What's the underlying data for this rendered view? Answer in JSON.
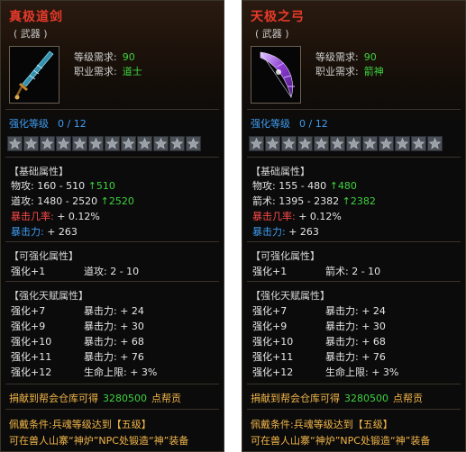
{
  "panels": [
    {
      "name": "真极道剑",
      "type": "( 武器 )",
      "req_level_label": "等级需求:",
      "req_level_value": "90",
      "req_job_label": "职业需求:",
      "req_job_value": "道士",
      "enhance_label": "强化等级",
      "enhance_value": "0 / 12",
      "stars": 12,
      "base_title": "【基础属性】",
      "base_stats": [
        {
          "label": "物攻:",
          "value": "160 - 510",
          "bonus": "510",
          "color": "#e6e6e6"
        },
        {
          "label": "道攻:",
          "value": "1480 - 2520",
          "bonus": "2520",
          "color": "#e6e6e6"
        },
        {
          "label": "暴击几率:",
          "value": "+ 0.12%",
          "bonus": "",
          "color": "#ff4a4a"
        },
        {
          "label": "暴击力:",
          "value": "+ 263",
          "bonus": "",
          "color": "#3e9cf0"
        }
      ],
      "enh_title": "【可强化属性】",
      "enh_left": "强化+1",
      "enh_right": "道攻: 2 - 10",
      "talent_title": "【强化天赋属性】",
      "talents": [
        {
          "lv": "强化+7",
          "attr": "暴击力: + 24"
        },
        {
          "lv": "强化+9",
          "attr": "暴击力: + 30"
        },
        {
          "lv": "强化+10",
          "attr": "暴击力: + 68"
        },
        {
          "lv": "强化+11",
          "attr": "暴击力: + 76"
        },
        {
          "lv": "强化+12",
          "attr": "生命上限: + 3%"
        }
      ],
      "donate_prefix": "捐献到帮会仓库可得",
      "donate_value": "3280500",
      "donate_suffix": "点帮贡",
      "cond1": "佩戴条件:兵魂等级达到【五级】",
      "cond2": "可在兽人山寨“神炉”NPC处锻造“神”装备"
    },
    {
      "name": "天极之弓",
      "type": "( 武器 )",
      "req_level_label": "等级需求:",
      "req_level_value": "90",
      "req_job_label": "职业需求:",
      "req_job_value": "箭神",
      "enhance_label": "强化等级",
      "enhance_value": "0 / 12",
      "stars": 12,
      "base_title": "【基础属性】",
      "base_stats": [
        {
          "label": "物攻:",
          "value": "155 - 480",
          "bonus": "480",
          "color": "#e6e6e6"
        },
        {
          "label": "箭术:",
          "value": "1395 - 2382",
          "bonus": "2382",
          "color": "#e6e6e6"
        },
        {
          "label": "暴击几率:",
          "value": "+ 0.12%",
          "bonus": "",
          "color": "#ff4a4a"
        },
        {
          "label": "暴击力:",
          "value": "+ 263",
          "bonus": "",
          "color": "#3e9cf0"
        }
      ],
      "enh_title": "【可强化属性】",
      "enh_left": "强化+1",
      "enh_right": "箭术: 2 - 10",
      "talent_title": "【强化天赋属性】",
      "talents": [
        {
          "lv": "强化+7",
          "attr": "暴击力: + 24"
        },
        {
          "lv": "强化+9",
          "attr": "暴击力: + 30"
        },
        {
          "lv": "强化+10",
          "attr": "暴击力: + 68"
        },
        {
          "lv": "强化+11",
          "attr": "暴击力: + 76"
        },
        {
          "lv": "强化+12",
          "attr": "生命上限: + 3%"
        }
      ],
      "donate_prefix": "捐献到帮会仓库可得",
      "donate_value": "3280500",
      "donate_suffix": "点帮贡",
      "cond1": "佩戴条件:兵魂等级达到【五级】",
      "cond2": "可在兽人山寨“神炉”NPC处锻造“神”装备"
    }
  ]
}
